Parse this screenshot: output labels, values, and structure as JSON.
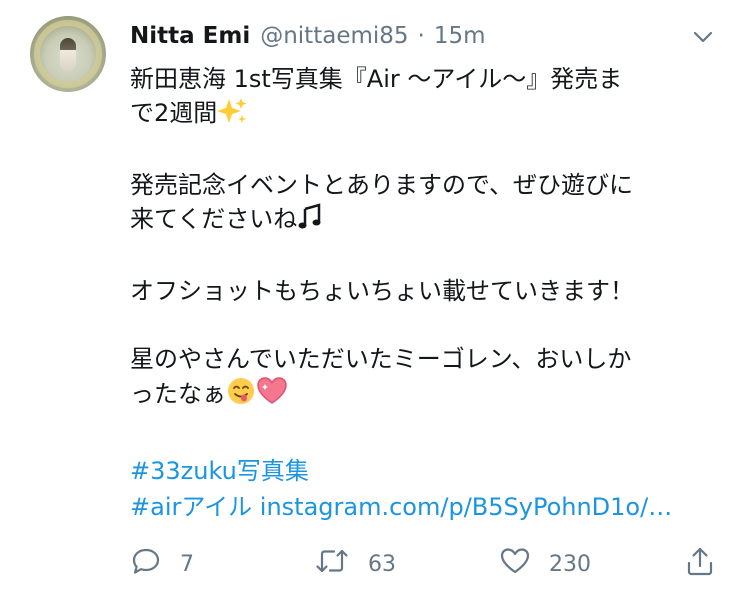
{
  "tweet": {
    "display_name": "Nitta Emi",
    "handle": "@nittaemi85",
    "separator": "·",
    "time": "15m",
    "lines": {
      "l1": "新田恵海 1st写真集『Air 〜アイル〜』発売ま",
      "l2": "で2週間",
      "l3": "発売記念イベントとありますので、ぜひ遊びに",
      "l4": "来てくださいね",
      "l5": "オフショットもちょいちょい載せていきます！",
      "l6": "星のやさんでいただいたミーゴレン、おいしか",
      "l7": "ったなぁ"
    },
    "hashtag1": "#33zuku写真集",
    "hashtag2": "#airアイル",
    "link": "instagram.com/p/B5SyPohnD1o/…"
  },
  "actions": {
    "reply_count": "7",
    "retweet_count": "63",
    "like_count": "230"
  },
  "icons": {
    "menu": "chevron-down-icon",
    "reply": "reply-icon",
    "retweet": "retweet-icon",
    "like": "heart-icon",
    "share": "share-icon"
  },
  "colors": {
    "link": "#1b95e0",
    "muted": "#657786",
    "text": "#14171a"
  }
}
